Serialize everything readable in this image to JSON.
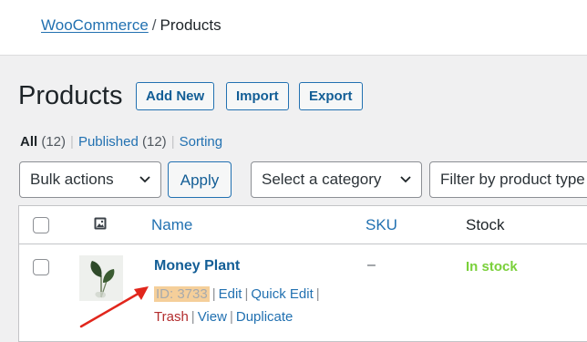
{
  "breadcrumb": {
    "parent": "WooCommerce",
    "separator": "/",
    "current": "Products"
  },
  "page": {
    "title": "Products",
    "add_new": "Add New",
    "import": "Import",
    "export": "Export"
  },
  "filters": {
    "all_label": "All",
    "all_count": "(12)",
    "published_label": "Published",
    "published_count": "(12)",
    "sorting_label": "Sorting",
    "divider": "|"
  },
  "toolbar": {
    "bulk_actions": "Bulk actions",
    "apply": "Apply",
    "category": "Select a category",
    "product_type": "Filter by product type"
  },
  "table": {
    "columns": {
      "name": "Name",
      "sku": "SKU",
      "stock": "Stock"
    },
    "rows": [
      {
        "name": "Money Plant",
        "id": "ID: 3733",
        "sku": "–",
        "stock": "In stock",
        "actions": {
          "edit": "Edit",
          "quick_edit": "Quick Edit",
          "trash": "Trash",
          "view": "View",
          "duplicate": "Duplicate"
        }
      }
    ]
  },
  "colors": {
    "link": "#2271b1",
    "in_stock": "#7ad03a",
    "trash": "#b32d2e",
    "id_highlight": "#f5cf9a",
    "annotation_arrow": "#e1261c"
  },
  "icons": {
    "dropdown": "chevron-down-icon",
    "image_column": "image-icon",
    "annotation": "red-arrow"
  }
}
